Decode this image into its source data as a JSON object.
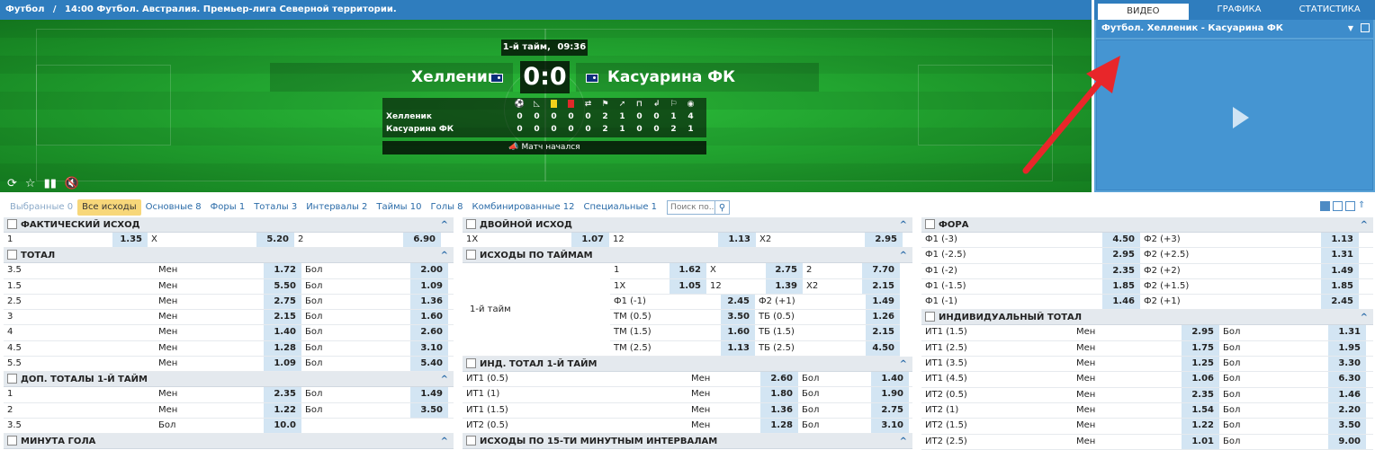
{
  "breadcrumb": {
    "sport": "Футбол",
    "sep": "/",
    "event": "14:00 Футбол. Австралия. Премьер-лига Северной территории."
  },
  "match": {
    "period": "1-й тайм,",
    "clock": "09:36",
    "home": "Хелленик",
    "away": "Касуарина ФК",
    "score": "0:0",
    "status": "Матч начался",
    "stats": {
      "columns": [
        "ball-icon",
        "corner-icon",
        "yellow-card-icon",
        "red-card-icon",
        "substitution-icon",
        "flag-icon",
        "attack-icon",
        "goal-kick-icon",
        "throw-in-icon",
        "free-kick-icon",
        "penalty-icon"
      ],
      "home": [
        "0",
        "0",
        "0",
        "0",
        "0",
        "2",
        "1",
        "0",
        "0",
        "1",
        "4"
      ],
      "away": [
        "0",
        "0",
        "0",
        "0",
        "0",
        "2",
        "1",
        "0",
        "0",
        "2",
        "1"
      ]
    }
  },
  "video": {
    "tabs": [
      "ВИДЕО",
      "ГРАФИКА",
      "СТАТИСТИКА"
    ],
    "selected": "Футбол. Хелленик - Касуарина ФК"
  },
  "filters": {
    "items": [
      {
        "label": "Выбранные 0",
        "state": "muted"
      },
      {
        "label": "Все исходы",
        "state": "active"
      },
      {
        "label": "Основные 8",
        "state": "normal"
      },
      {
        "label": "Форы 1",
        "state": "normal"
      },
      {
        "label": "Тоталы 3",
        "state": "normal"
      },
      {
        "label": "Интервалы 2",
        "state": "normal"
      },
      {
        "label": "Таймы 10",
        "state": "normal"
      },
      {
        "label": "Голы 8",
        "state": "normal"
      },
      {
        "label": "Комбинированные 12",
        "state": "normal"
      },
      {
        "label": "Специальные 1",
        "state": "normal"
      }
    ],
    "search_placeholder": "Поиск по..."
  },
  "col1": {
    "g1": {
      "title": "ФАКТИЧЕСКИЙ ИСХОД",
      "rows": [
        [
          "1",
          "1.35",
          "X",
          "5.20",
          "2",
          "6.90"
        ]
      ]
    },
    "g2": {
      "title": "ТОТАЛ",
      "rows": [
        [
          "3.5",
          "Мен",
          "1.72",
          "Бол",
          "2.00"
        ],
        [
          "1.5",
          "Мен",
          "5.50",
          "Бол",
          "1.09"
        ],
        [
          "2.5",
          "Мен",
          "2.75",
          "Бол",
          "1.36"
        ],
        [
          "3",
          "Мен",
          "2.15",
          "Бол",
          "1.60"
        ],
        [
          "4",
          "Мен",
          "1.40",
          "Бол",
          "2.60"
        ],
        [
          "4.5",
          "Мен",
          "1.28",
          "Бол",
          "3.10"
        ],
        [
          "5.5",
          "Мен",
          "1.09",
          "Бол",
          "5.40"
        ]
      ]
    },
    "g3": {
      "title": "ДОП. ТОТАЛЫ 1-Й ТАЙМ",
      "rows": [
        [
          "1",
          "Мен",
          "2.35",
          "Бол",
          "1.49"
        ],
        [
          "2",
          "Мен",
          "1.22",
          "Бол",
          "3.50"
        ],
        [
          "3.5",
          "Бол",
          "10.0",
          "",
          ""
        ]
      ]
    },
    "g4": {
      "title": "МИНУТА ГОЛА"
    }
  },
  "col2": {
    "g1": {
      "title": "ДВОЙНОЙ ИСХОД",
      "rows": [
        [
          "1X",
          "1.07",
          "12",
          "1.13",
          "X2",
          "2.95"
        ]
      ]
    },
    "g2": {
      "title": "ИСХОДЫ ПО ТАЙМАМ",
      "label": "1-й тайм",
      "rows": [
        [
          "1",
          "1.62",
          "X",
          "2.75",
          "2",
          "7.70"
        ],
        [
          "1X",
          "1.05",
          "12",
          "1.39",
          "X2",
          "2.15"
        ]
      ],
      "rows2": [
        [
          "Ф1 (-1)",
          "2.45",
          "Ф2 (+1)",
          "1.49"
        ],
        [
          "ТМ (0.5)",
          "3.50",
          "ТБ (0.5)",
          "1.26"
        ],
        [
          "ТМ (1.5)",
          "1.60",
          "ТБ (1.5)",
          "2.15"
        ],
        [
          "ТМ (2.5)",
          "1.13",
          "ТБ (2.5)",
          "4.50"
        ]
      ]
    },
    "g3": {
      "title": "ИНД. ТОТАЛ 1-Й ТАЙМ",
      "rows": [
        [
          "ИТ1 (0.5)",
          "Мен",
          "2.60",
          "Бол",
          "1.40"
        ],
        [
          "ИТ1 (1)",
          "Мен",
          "1.80",
          "Бол",
          "1.90"
        ],
        [
          "ИТ1 (1.5)",
          "Мен",
          "1.36",
          "Бол",
          "2.75"
        ],
        [
          "ИТ2 (0.5)",
          "Мен",
          "1.28",
          "Бол",
          "3.10"
        ]
      ]
    },
    "g4": {
      "title": "ИСХОДЫ ПО 15-ТИ МИНУТНЫМ ИНТЕРВАЛАМ"
    }
  },
  "col3": {
    "g1": {
      "title": "ФОРА",
      "rows": [
        [
          "Ф1 (-3)",
          "4.50",
          "Ф2 (+3)",
          "1.13"
        ],
        [
          "Ф1 (-2.5)",
          "2.95",
          "Ф2 (+2.5)",
          "1.31"
        ],
        [
          "Ф1 (-2)",
          "2.35",
          "Ф2 (+2)",
          "1.49"
        ],
        [
          "Ф1 (-1.5)",
          "1.85",
          "Ф2 (+1.5)",
          "1.85"
        ],
        [
          "Ф1 (-1)",
          "1.46",
          "Ф2 (+1)",
          "2.45"
        ]
      ]
    },
    "g2": {
      "title": "ИНДИВИДУАЛЬНЫЙ ТОТАЛ",
      "rows": [
        [
          "ИТ1 (1.5)",
          "Мен",
          "2.95",
          "Бол",
          "1.31"
        ],
        [
          "ИТ1 (2.5)",
          "Мен",
          "1.75",
          "Бол",
          "1.95"
        ],
        [
          "ИТ1 (3.5)",
          "Мен",
          "1.25",
          "Бол",
          "3.30"
        ],
        [
          "ИТ1 (4.5)",
          "Мен",
          "1.06",
          "Бол",
          "6.30"
        ],
        [
          "ИТ2 (0.5)",
          "Мен",
          "2.35",
          "Бол",
          "1.46"
        ],
        [
          "ИТ2 (1)",
          "Мен",
          "1.54",
          "Бол",
          "2.20"
        ],
        [
          "ИТ2 (1.5)",
          "Мен",
          "1.22",
          "Бол",
          "3.50"
        ],
        [
          "ИТ2 (2.5)",
          "Мен",
          "1.01",
          "Бол",
          "9.00"
        ]
      ]
    }
  }
}
